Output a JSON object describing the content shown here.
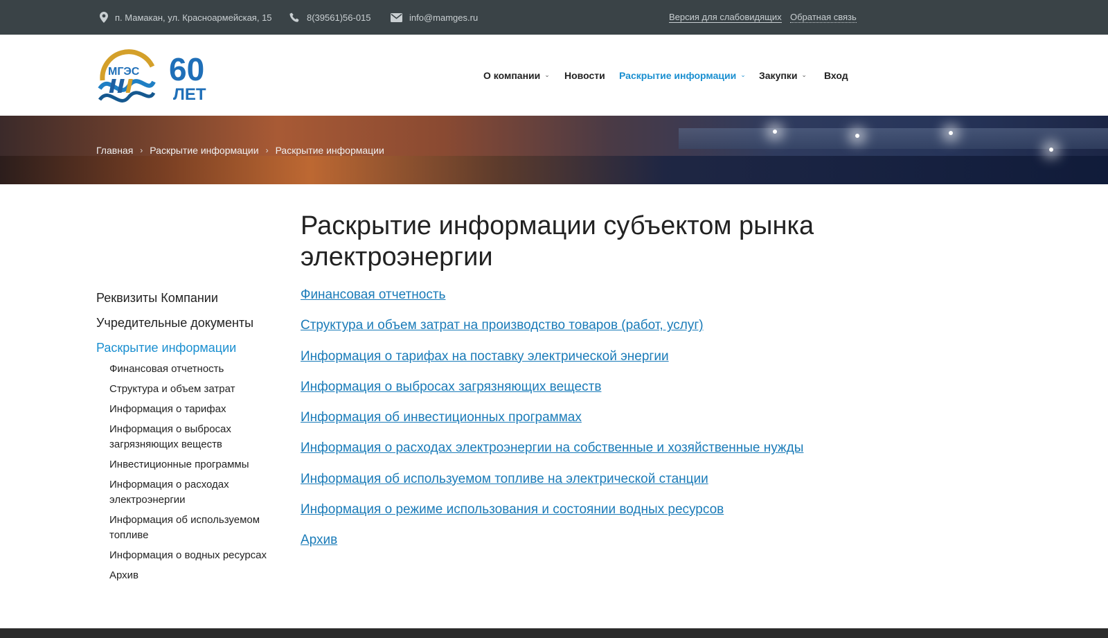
{
  "topbar": {
    "address": "п. Мамакан, ул. Красноармейская, 15",
    "phone": "8(39561)56-015",
    "email": "info@mamges.ru",
    "accessibility_link": "Версия для слабовидящих",
    "feedback_link": "Обратная связь"
  },
  "header": {
    "logo_text": "МГЭС",
    "logo_years_number": "60",
    "logo_years_word": "ЛЕТ",
    "nav": [
      {
        "label": "О компании",
        "has_dropdown": true
      },
      {
        "label": "Новости",
        "has_dropdown": false
      },
      {
        "label": "Раскрытие информации",
        "has_dropdown": true,
        "active": true
      },
      {
        "label": "Закупки",
        "has_dropdown": true
      },
      {
        "label": "Вход",
        "has_dropdown": false
      }
    ]
  },
  "breadcrumb": [
    "Главная",
    "Раскрытие информации",
    "Раскрытие информации"
  ],
  "sidebar": {
    "items": [
      {
        "label": "Реквизиты Компании"
      },
      {
        "label": "Учредительные документы"
      },
      {
        "label": "Раскрытие информации",
        "active": true
      }
    ],
    "subitems": [
      "Финансовая отчетность",
      "Структура и объем затрат",
      "Информация о тарифах",
      "Информация о выбросах загрязняющих веществ",
      "Инвестиционные программы",
      "Информация о расходах электроэнергии",
      "Информация об используемом топливе",
      "Информация о водных ресурсах",
      "Архив"
    ]
  },
  "main": {
    "title": "Раскрытие информации субъектом рынка электроэнергии",
    "links": [
      "Финансовая отчетность",
      "Структура и объем затрат на производство товаров (работ, услуг)",
      "Информация о тарифах на поставку электрической энергии",
      "Информация о выбросах загрязняющих веществ",
      "Информация об инвестиционных программах",
      "Информация о расходах электроэнергии на собственные и хозяйственные нужды",
      "Информация об используемом топливе на электрической станции",
      "Информация о режиме использования и состоянии водных ресурсов",
      "Архив"
    ]
  },
  "colors": {
    "topbar_bg": "#3a4347",
    "accent": "#1a8fd0",
    "link": "#1a7bb8",
    "footer_bg": "#2b2b2b"
  },
  "icons": {
    "address": "map-pin-icon",
    "phone": "phone-icon",
    "email": "envelope-icon",
    "dropdown": "chevron-down-icon",
    "breadcrumb_separator": "chevron-right-icon"
  }
}
